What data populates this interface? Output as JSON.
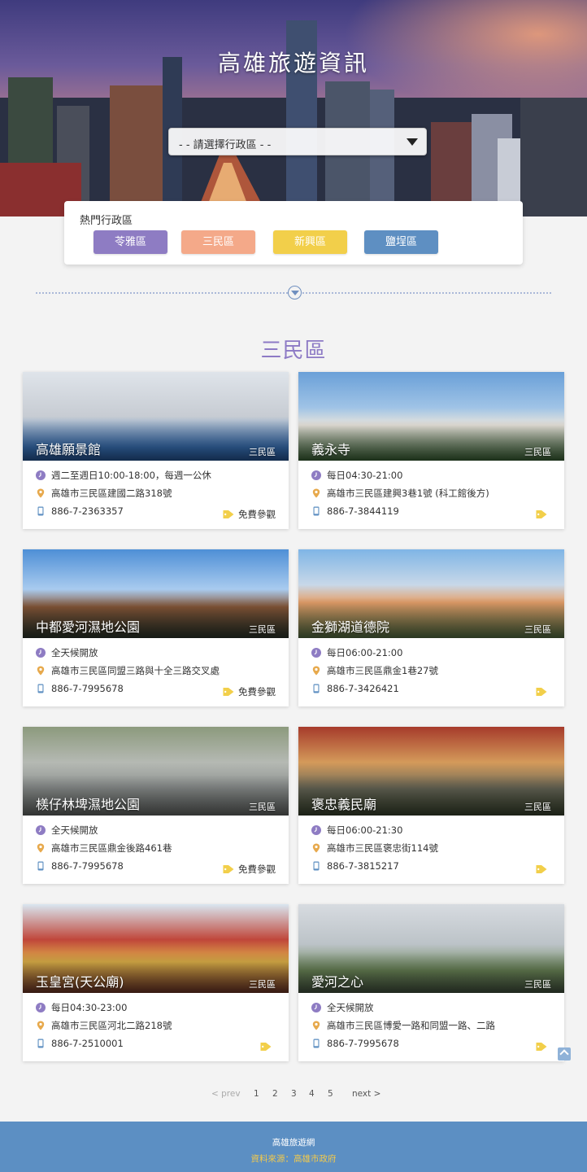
{
  "hero": {
    "title": "高雄旅遊資訊"
  },
  "select": {
    "placeholder": "- - 請選擇行政區 - -"
  },
  "popular": {
    "label": "熱門行政區",
    "buttons": [
      {
        "label": "苓雅區",
        "color": "#8e7cc3"
      },
      {
        "label": "三民區",
        "color": "#f4a989"
      },
      {
        "label": "新興區",
        "color": "#f2cf4a"
      },
      {
        "label": "鹽埕區",
        "color": "#5e8fc2"
      }
    ]
  },
  "section": {
    "title": "三民區"
  },
  "cards": [
    {
      "name": "高雄願景館",
      "district": "三民區",
      "hours": "週二至週日10:00-18:00，每週一公休",
      "address": "高雄市三民區建國二路318號",
      "phone": "886-7-2363357",
      "ticket": "免費參觀"
    },
    {
      "name": "義永寺",
      "district": "三民區",
      "hours": "每日04:30-21:00",
      "address": "高雄市三民區建興3巷1號 (科工館後方)",
      "phone": "886-7-3844119",
      "ticket": ""
    },
    {
      "name": "中都愛河濕地公園",
      "district": "三民區",
      "hours": "全天候開放",
      "address": "高雄市三民區同盟三路與十全三路交叉處",
      "phone": "886-7-7995678",
      "ticket": "免費參觀"
    },
    {
      "name": "金獅湖道德院",
      "district": "三民區",
      "hours": "每日06:00-21:00",
      "address": "高雄市三民區鼎金1巷27號",
      "phone": "886-7-3426421",
      "ticket": ""
    },
    {
      "name": "檨仔林埤濕地公園",
      "district": "三民區",
      "hours": "全天候開放",
      "address": "高雄市三民區鼎金後路461巷",
      "phone": "886-7-7995678",
      "ticket": "免費參觀"
    },
    {
      "name": "褒忠義民廟",
      "district": "三民區",
      "hours": "每日06:00-21:30",
      "address": "高雄市三民區褒忠街114號",
      "phone": "886-7-3815217",
      "ticket": ""
    },
    {
      "name": "玉皇宮(天公廟)",
      "district": "三民區",
      "hours": "每日04:30-23:00",
      "address": "高雄市三民區河北二路218號",
      "phone": "886-7-2510001",
      "ticket": ""
    },
    {
      "name": "愛河之心",
      "district": "三民區",
      "hours": "全天候開放",
      "address": "高雄市三民區博愛一路和同盟一路、二路",
      "phone": "886-7-7995678",
      "ticket": ""
    }
  ],
  "pagination": {
    "prev": "< prev",
    "pages": [
      "1",
      "2",
      "3",
      "4",
      "5"
    ],
    "next": "next >"
  },
  "footer": {
    "site": "高雄旅遊網",
    "source": "資料來源：高雄市政府"
  },
  "colors": {
    "accent": "#8d7ac5",
    "footer": "#5c8fc3",
    "icon": "#8e7cc3",
    "pin": "#e7a94c",
    "phone": "#5e8fc2",
    "tag": "#f2cf4a"
  }
}
